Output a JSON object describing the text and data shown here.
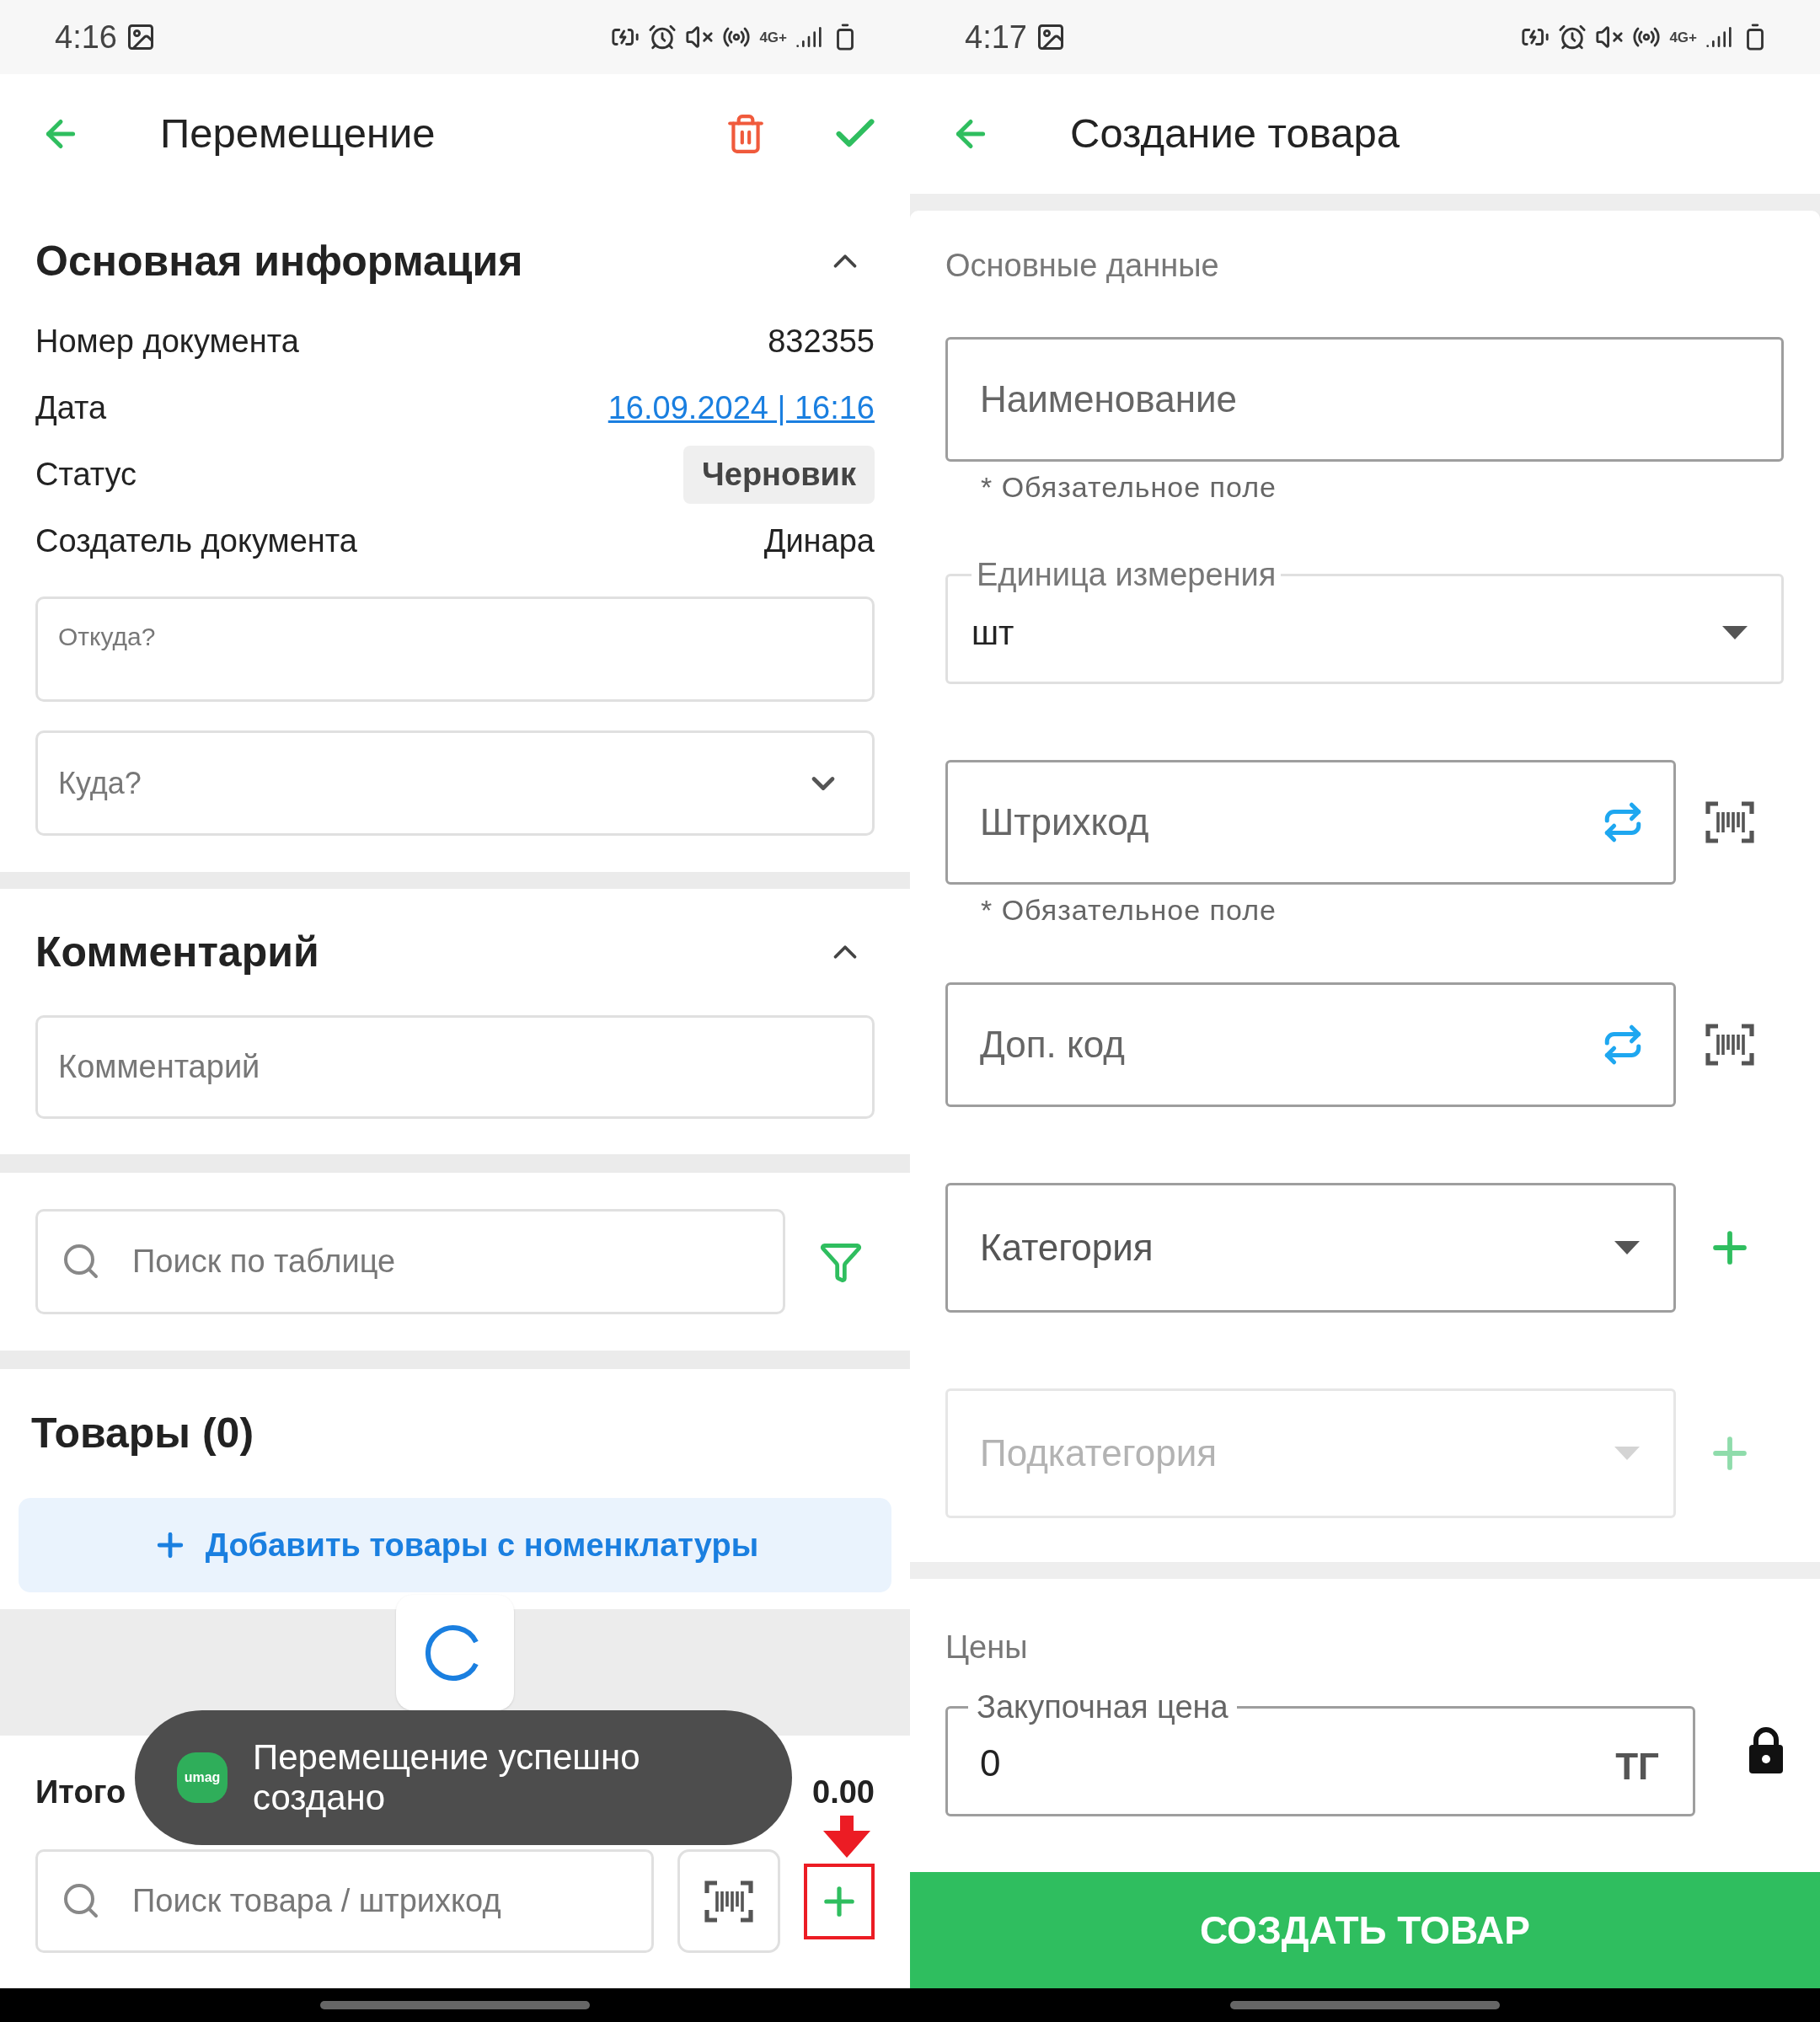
{
  "left_screen": {
    "status_bar": {
      "time": "4:16",
      "network_type": "4G+"
    },
    "header": {
      "title": "Перемещение"
    },
    "main_info": {
      "title": "Основная информация",
      "expanded": true,
      "rows": [
        {
          "kind": "text",
          "label": "Номер документа",
          "value": "832355"
        },
        {
          "kind": "link",
          "label": "Дата",
          "value": "16.09.2024 | 16:16"
        },
        {
          "kind": "chip",
          "label": "Статус",
          "value": "Черновик"
        },
        {
          "kind": "text",
          "label": "Создатель документа",
          "value": "Динара"
        }
      ],
      "from_field": {
        "label": "Откуда?"
      },
      "to_field": {
        "placeholder": "Куда?"
      }
    },
    "comment": {
      "title": "Комментарий",
      "expanded": true,
      "field": {
        "placeholder": "Комментарий"
      }
    },
    "table_search": {
      "placeholder": "Поиск по таблице"
    },
    "products": {
      "title": "Товары (0)",
      "add_button": "Добавить товары с номенклатуры"
    },
    "total": {
      "label": "Итого",
      "value": "0.00"
    },
    "toast": {
      "logo": "umag",
      "message": "Перемещение успешно создано"
    },
    "product_search": {
      "placeholder": "Поиск товара / штрихкод"
    }
  },
  "right_screen": {
    "status_bar": {
      "time": "4:17",
      "network_type": "4G+"
    },
    "header": {
      "title": "Создание товара"
    },
    "basic": {
      "title": "Основные данные",
      "fields": [
        {
          "kind": "input",
          "placeholder": "Наименование",
          "hint": "* Обязательное поле"
        },
        {
          "kind": "select",
          "label": "Единица измерения",
          "value": "шт"
        },
        {
          "kind": "scan",
          "placeholder": "Штрихкод",
          "hint": "* Обязательное поле"
        },
        {
          "kind": "scan",
          "placeholder": "Доп. код"
        },
        {
          "kind": "category",
          "placeholder": "Категория",
          "disabled": false
        },
        {
          "kind": "category",
          "placeholder": "Подкатегория",
          "disabled": true
        }
      ]
    },
    "prices": {
      "title": "Цены",
      "field": {
        "label": "Закупочная цена",
        "value": "0",
        "suffix": "ТГ"
      }
    },
    "submit": "СОЗДАТЬ ТОВАР"
  }
}
